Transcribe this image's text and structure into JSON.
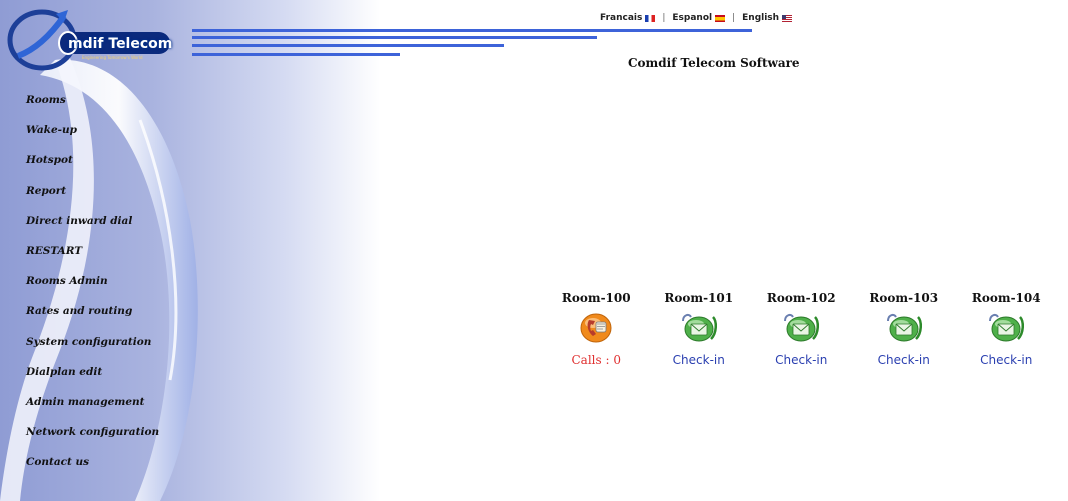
{
  "header": {
    "logo_text": "mdif Telecom",
    "logo_subtext": "Engineering Tomorrow's World",
    "page_title": "Comdif Telecom Software"
  },
  "languages": [
    {
      "label": "Francais",
      "flag": "fr-flag-icon"
    },
    {
      "label": "Espanol",
      "flag": "es-flag-icon"
    },
    {
      "label": "English",
      "flag": "us-flag-icon"
    }
  ],
  "nav": {
    "items": [
      {
        "label": "Rooms"
      },
      {
        "label": "Wake-up"
      },
      {
        "label": "Hotspot"
      },
      {
        "label": "Report"
      },
      {
        "label": "Direct inward dial"
      },
      {
        "label": "RESTART"
      },
      {
        "label": "Rooms Admin"
      },
      {
        "label": "Rates and routing"
      },
      {
        "label": "System configuration"
      },
      {
        "label": "Dialplan edit"
      },
      {
        "label": "Admin management"
      },
      {
        "label": "Network configuration"
      },
      {
        "label": "Contact us"
      }
    ]
  },
  "rooms": [
    {
      "name": "Room-100",
      "status": "Calls : 0",
      "icon": "phone-in-use-icon"
    },
    {
      "name": "Room-101",
      "status": "Check-in",
      "icon": "phone-envelope-icon"
    },
    {
      "name": "Room-102",
      "status": "Check-in",
      "icon": "phone-envelope-icon"
    },
    {
      "name": "Room-103",
      "status": "Check-in",
      "icon": "phone-envelope-icon"
    },
    {
      "name": "Room-104",
      "status": "Check-in",
      "icon": "phone-envelope-icon"
    }
  ],
  "colors": {
    "accent_lines": "#3d63d9",
    "calls_text": "#e03030",
    "checkin_text": "#2a3fb0"
  }
}
